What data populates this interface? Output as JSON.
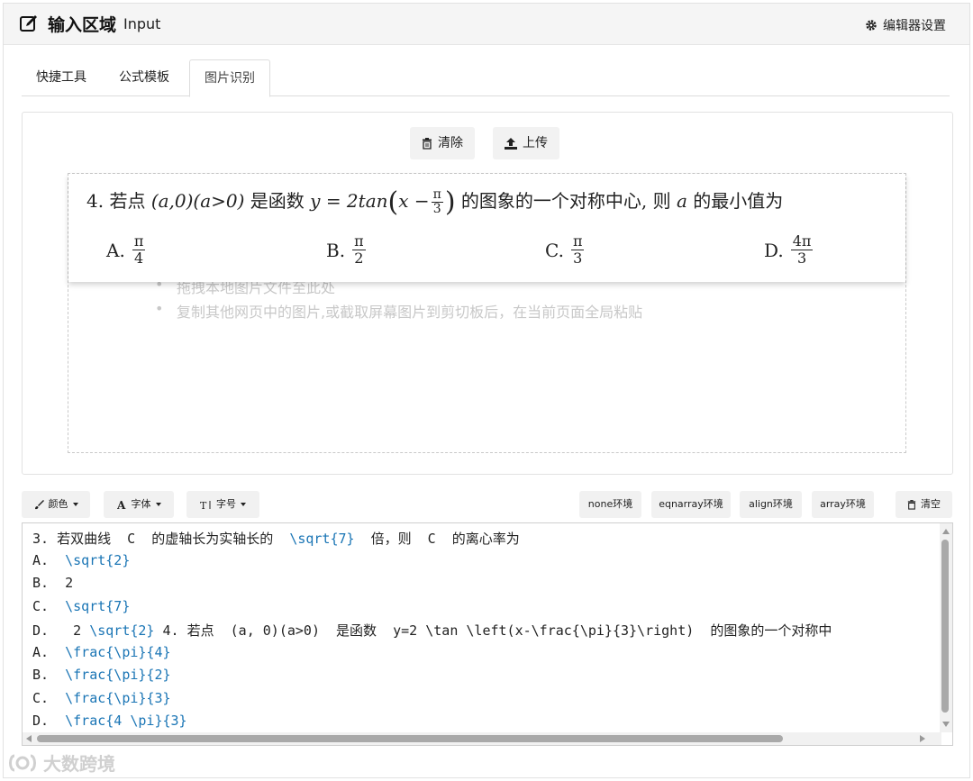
{
  "header": {
    "title": "输入区域",
    "subtitle": "Input",
    "settings_label": "编辑器设置"
  },
  "tabs": [
    {
      "label": "快捷工具",
      "active": false
    },
    {
      "label": "公式模板",
      "active": false
    },
    {
      "label": "图片识别",
      "active": true
    }
  ],
  "image_panel": {
    "clear_label": "清除",
    "upload_label": "上传",
    "hints": [
      "拖拽本地图片文件至此处",
      "复制其他网页中的图片,或截取屏幕图片到剪切板后，在当前页面全局粘贴"
    ],
    "preview": {
      "q_num": "4.",
      "q_text_a": "若点",
      "q_math_a": "(a,0)(a>0)",
      "q_text_b": "是函数",
      "q_math_b": "y = 2tan",
      "q_math_c": "x −",
      "q_frac_num": "π",
      "q_frac_den": "3",
      "q_text_c": "的图象的一个对称中心, 则",
      "q_var": "a",
      "q_text_d": "的最小值为",
      "options": [
        {
          "label": "A.",
          "num": "π",
          "den": "4"
        },
        {
          "label": "B.",
          "num": "π",
          "den": "2"
        },
        {
          "label": "C.",
          "num": "π",
          "den": "3"
        },
        {
          "label": "D.",
          "num": "4π",
          "den": "3"
        }
      ]
    }
  },
  "toolbar": {
    "color": "颜色",
    "font": "字体",
    "size": "字号",
    "env_none": "none环境",
    "env_eqnarray": "eqnarray环境",
    "env_align": "align环境",
    "env_array": "array环境",
    "clear": "清空"
  },
  "editor": {
    "lines": [
      [
        "3. 若双曲线  C  的虚轴长为实轴长的  ",
        "\\sqrt{7}",
        "  倍，则  C  的离心率为"
      ],
      [
        "A.  ",
        "\\sqrt{2}",
        ""
      ],
      [
        "B.  2",
        "",
        ""
      ],
      [
        "C.  ",
        "\\sqrt{7}",
        ""
      ],
      [
        "D.   2 ",
        "\\sqrt{2}",
        " 4. 若点  (a, 0)(a>0)  是函数  y=2 \\tan \\left(x-\\frac{\\pi}{3}\\right)  的图象的一个对称中"
      ],
      [
        "A.  ",
        "\\frac{\\pi}{4}",
        ""
      ],
      [
        "B.  ",
        "\\frac{\\pi}{2}",
        ""
      ],
      [
        "C.  ",
        "\\frac{\\pi}{3}",
        ""
      ],
      [
        "D.  ",
        "\\frac{4 \\pi}{3}",
        ""
      ]
    ]
  },
  "watermark": "大数跨境",
  "colors": {
    "latex_command": "#1a75b5",
    "latex_brace": "#2a8a3a",
    "header_bg": "#f5f5f5"
  }
}
